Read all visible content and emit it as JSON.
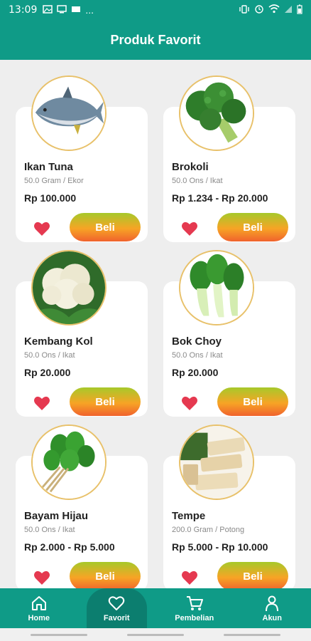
{
  "status_bar": {
    "time": "13:09",
    "signal_text": "..."
  },
  "app_bar": {
    "title": "Produk Favorit"
  },
  "products": [
    {
      "name": "Ikan Tuna",
      "unit": "50.0 Gram / Ekor",
      "price": "Rp 100.000",
      "buy_label": "Beli",
      "image": "tuna-fish"
    },
    {
      "name": "Brokoli",
      "unit": "50.0 Ons / Ikat",
      "price": "Rp 1.234 - Rp 20.000",
      "buy_label": "Beli",
      "image": "broccoli"
    },
    {
      "name": "Kembang Kol",
      "unit": "50.0 Ons / Ikat",
      "price": "Rp 20.000",
      "buy_label": "Beli",
      "image": "cauliflower"
    },
    {
      "name": "Bok Choy",
      "unit": "50.0 Ons / Ikat",
      "price": "Rp 20.000",
      "buy_label": "Beli",
      "image": "bok-choy"
    },
    {
      "name": "Bayam Hijau",
      "unit": "50.0 Ons / Ikat",
      "price": "Rp 2.000 - Rp 5.000",
      "buy_label": "Beli",
      "image": "spinach"
    },
    {
      "name": "Tempe",
      "unit": "200.0 Gram / Potong",
      "price": "Rp 5.000 - Rp 10.000",
      "buy_label": "Beli",
      "image": "tempeh"
    }
  ],
  "bottom_nav": [
    {
      "label": "Home",
      "icon": "home-icon",
      "active": false
    },
    {
      "label": "Favorit",
      "icon": "heart-icon",
      "active": true
    },
    {
      "label": "Pembelian",
      "icon": "cart-icon",
      "active": false
    },
    {
      "label": "Akun",
      "icon": "user-icon",
      "active": false
    }
  ],
  "colors": {
    "primary": "#0f9b87",
    "heart": "#e53950",
    "button_gradient": [
      "#a7c92a",
      "#f7a425",
      "#f0622d"
    ]
  }
}
